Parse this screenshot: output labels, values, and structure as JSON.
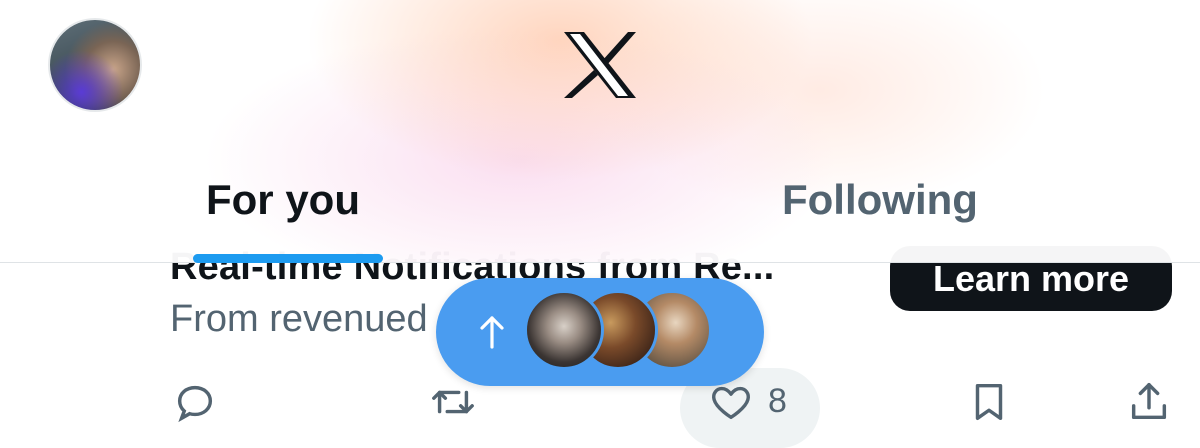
{
  "header": {
    "logo": "X",
    "avatar_icon": "profile-avatar",
    "tabs": [
      {
        "label": "For you",
        "active": true
      },
      {
        "label": "Following",
        "active": false
      }
    ],
    "accent_color": "#1d9bf0"
  },
  "ad": {
    "title": "Real-time Notifications from Re...",
    "subtitle": "From revenued",
    "cta_label": "Learn more"
  },
  "new_posts_pill": {
    "icon": "arrow-up-icon",
    "avatars": [
      "avatar-1",
      "avatar-2",
      "avatar-3"
    ],
    "color": "#4a9cf0"
  },
  "actions": {
    "reply_icon": "reply-icon",
    "repost_icon": "repost-icon",
    "like_icon": "heart-icon",
    "like_count": "8",
    "bookmark_icon": "bookmark-icon",
    "share_icon": "share-icon"
  }
}
